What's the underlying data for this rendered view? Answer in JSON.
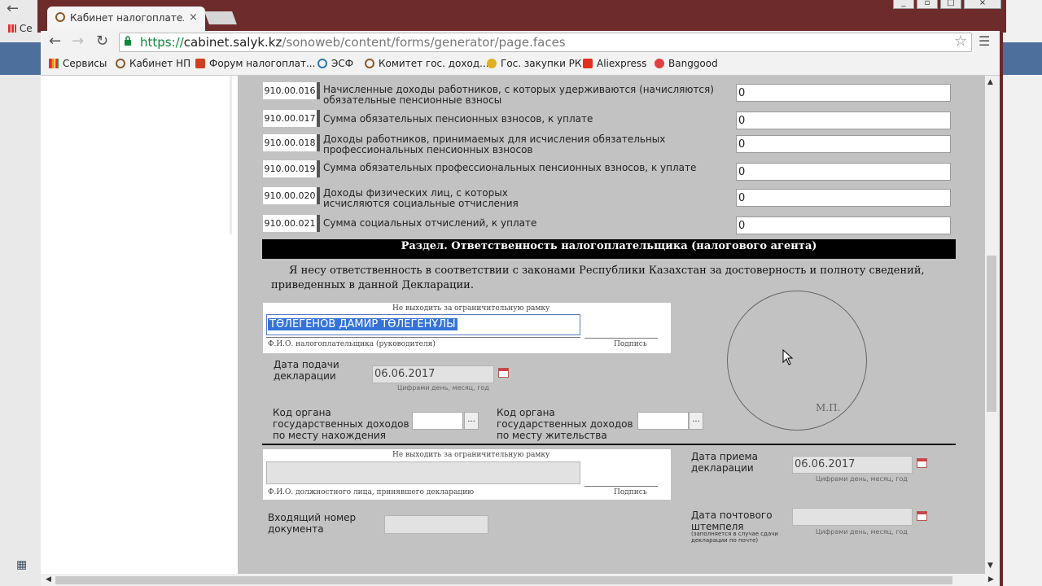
{
  "browser": {
    "tab_title": "Кабинет налогоплательщ",
    "tab_close": "×",
    "url_scheme": "https://",
    "url_host": "cabinet.salyk.kz",
    "url_path": "/sonoweb/content/forms/generator/page.faces",
    "bookmarks": [
      {
        "label": "Сервисы",
        "color": "#e0a020"
      },
      {
        "label": "Кабинет НП",
        "color": "#8a5a2a"
      },
      {
        "label": "Форум налогоплат...",
        "color": "#d04020"
      },
      {
        "label": "ЭСФ",
        "color": "#2a7ab0"
      },
      {
        "label": "Комитет гос. доход...",
        "color": "#8a5a2a"
      },
      {
        "label": "Гос. закупки РК",
        "color": "#e0b020"
      },
      {
        "label": "Aliexpress",
        "color": "#e03020"
      },
      {
        "label": "Banggood",
        "color": "#e04040"
      }
    ]
  },
  "desktop": {
    "left_label": "Се"
  },
  "rows": [
    {
      "code": "910.00.016",
      "label": "Начисленные доходы работников, с которых удерживаются (начисляются) обязательные пенсионные взносы",
      "value": "0"
    },
    {
      "code": "910.00.017",
      "label": "Сумма обязательных пенсионных взносов, к уплате",
      "value": "0"
    },
    {
      "code": "910.00.018",
      "label": "Доходы работников, принимаемых для исчисления обязательных профессиональных пенсионных взносов",
      "value": "0"
    },
    {
      "code": "910.00.019",
      "label": "Сумма обязательных профессиональных пенсионных взносов, к уплате",
      "value": "0"
    },
    {
      "code": "910.00.020",
      "label": "Доходы физических лиц, с которых исчисляются социальные отчисления",
      "value": "0"
    },
    {
      "code": "910.00.021",
      "label": "Сумма социальных отчислений, к уплате",
      "value": "0"
    }
  ],
  "section": {
    "title": "Раздел. Ответственность налогоплательщика (налогового агента)",
    "statement": "Я несу ответственность в соответствии с законами Республики Казахстан за достоверность и полноту сведений, приведенных в данной Декларации."
  },
  "taxpayer": {
    "frame_hint": "Не выходить за ограничительную рамку",
    "fio_value": "ТӨЛЕГЕНОВ ДАМИР ТӨЛЕГЕНҰЛЫ",
    "fio_caption": "Ф.И.О. налогоплательщика (руководителя)",
    "sign_caption": "Подпись",
    "submit_date_label": "Дата подачи декларации",
    "submit_date_value": "06.06.2017",
    "date_hint": "Цифрами день, месяц, год",
    "org_location_label": "Код органа государственных доходов по месту нахождения",
    "org_residence_label": "Код органа государственных доходов по месту жительства",
    "dots": "..."
  },
  "seal": {
    "label": "М.П."
  },
  "official": {
    "frame_hint": "Не выходить за ограничительную рамку",
    "fio_caption": "Ф.И.О. должностного лица, принявшего декларацию",
    "sign_caption": "Подпись",
    "receive_date_label": "Дата приема декларации",
    "receive_date_value": "06.06.2017",
    "date_hint": "Цифрами день, месяц, год",
    "incoming_label": "Входящий номер документа",
    "postmark_label": "Дата почтового штемпеля",
    "postmark_note": "(заполняется в случае сдачи декларации по почте)",
    "postmark_hint": "Цифрами день, месяц, год"
  }
}
